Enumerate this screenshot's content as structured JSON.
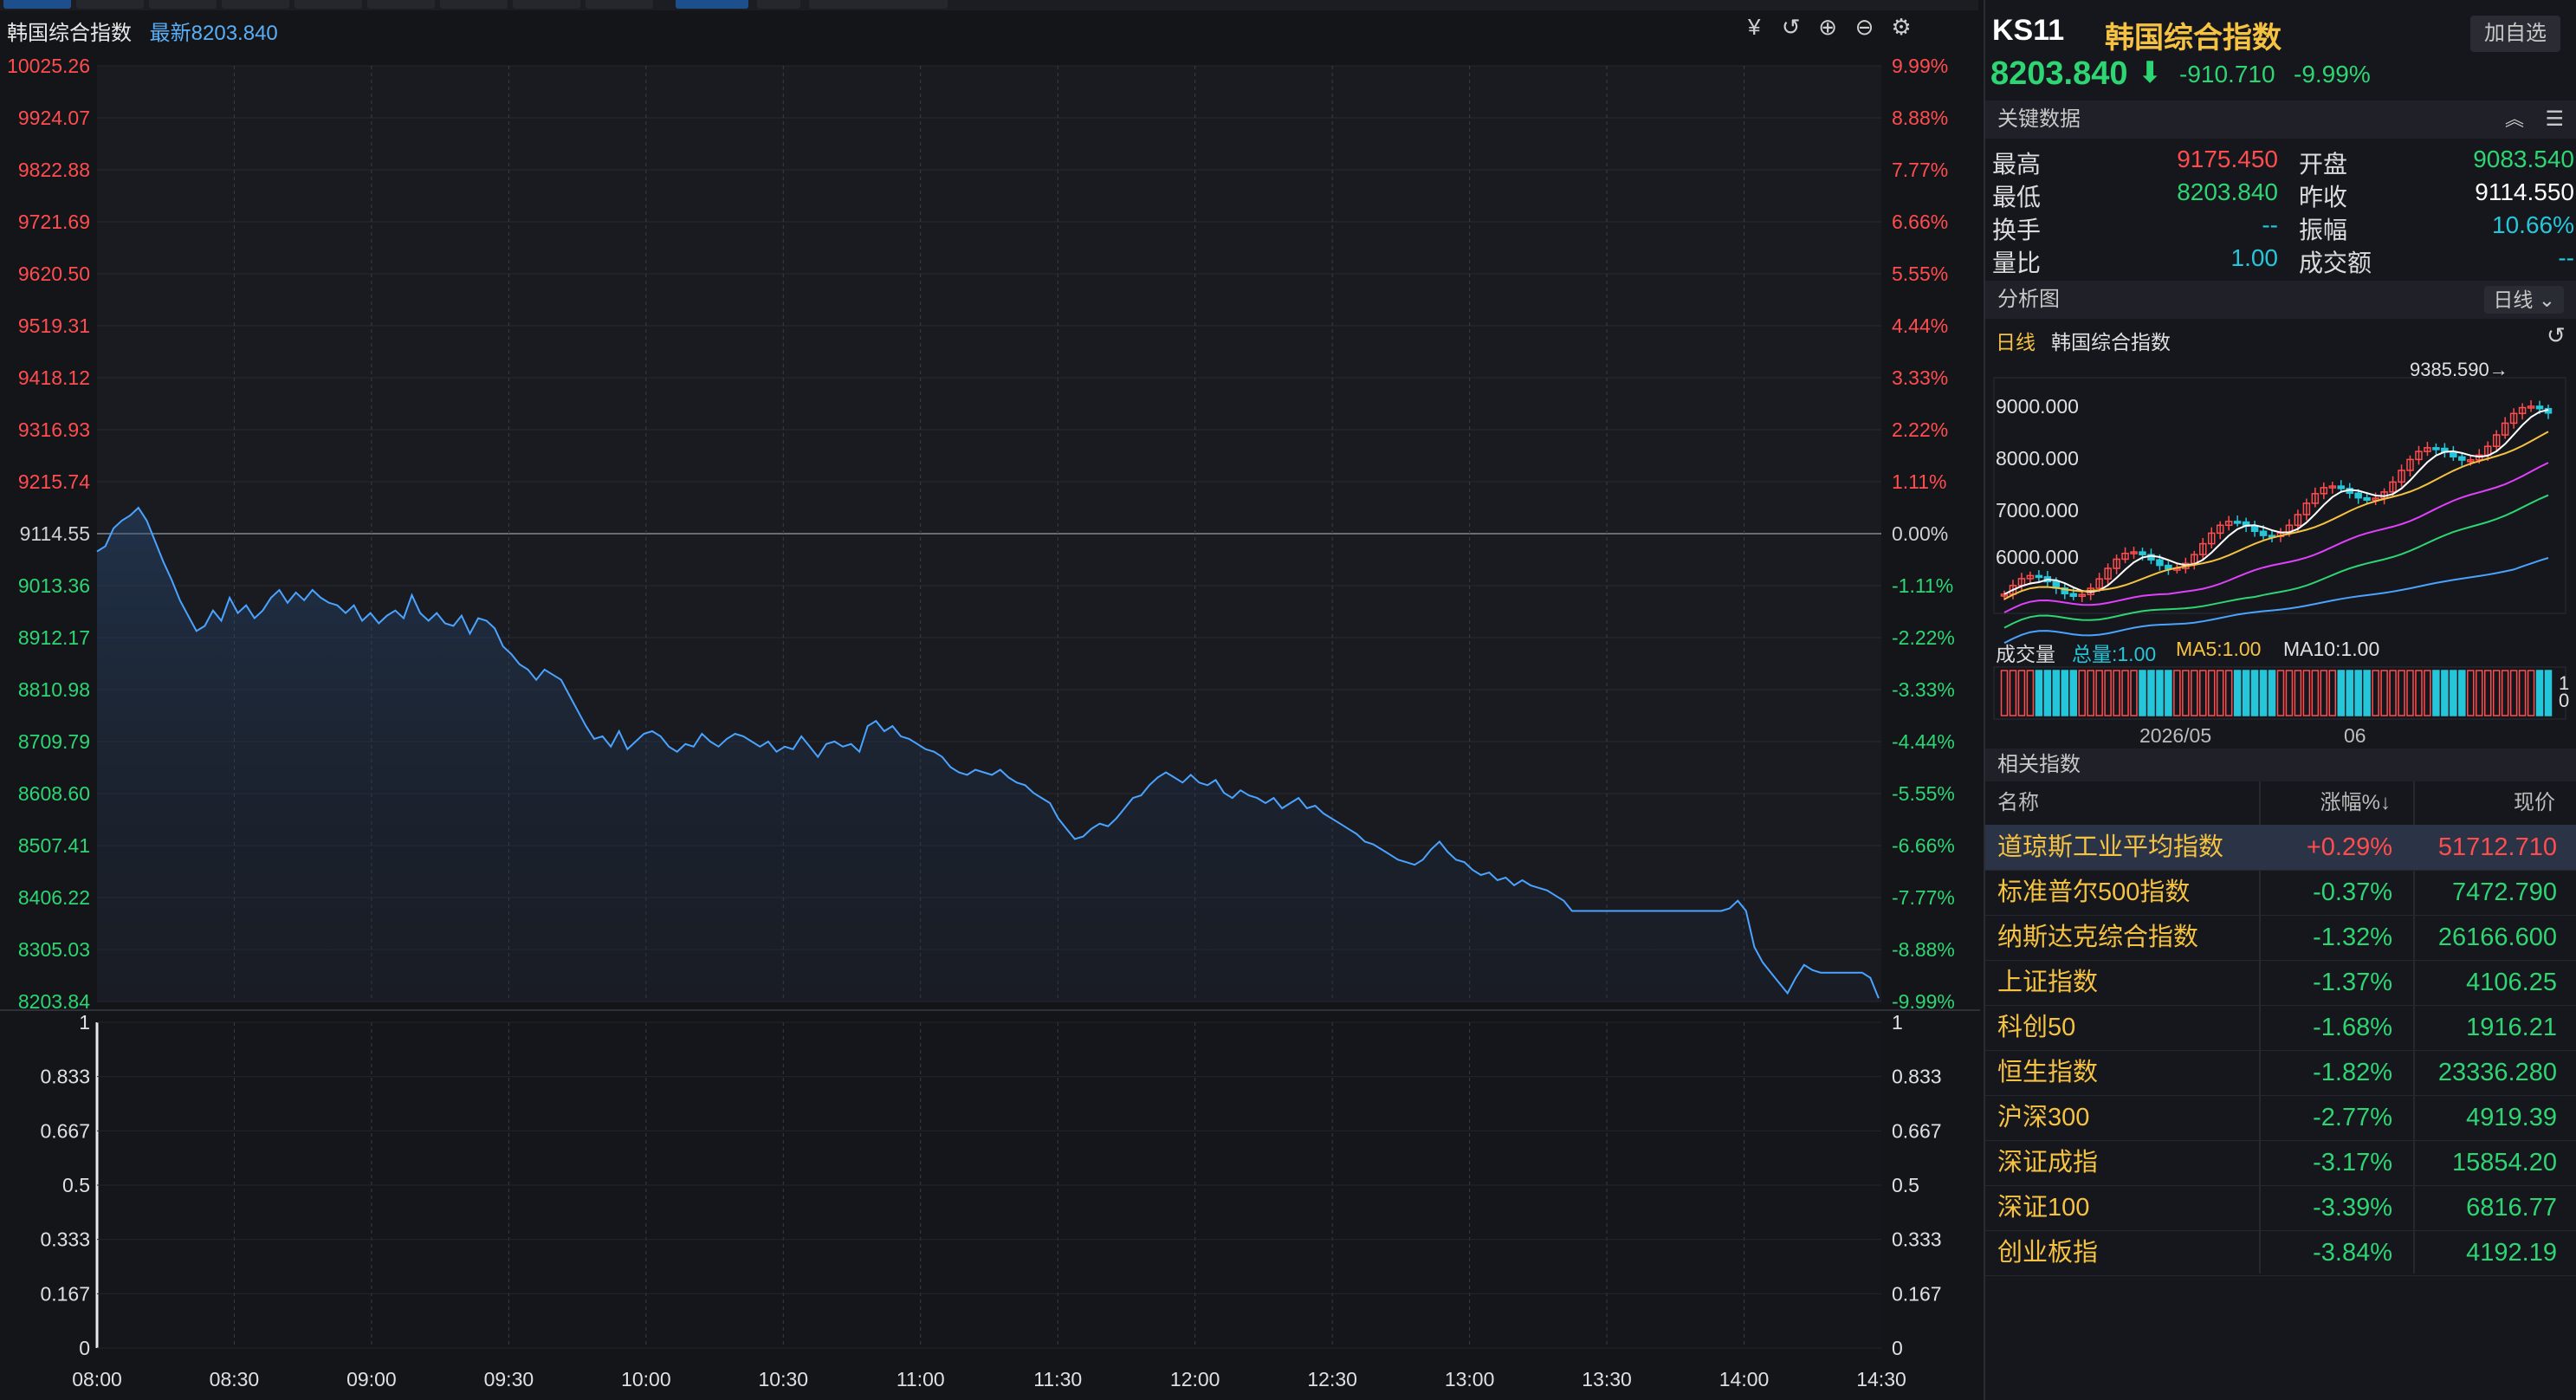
{
  "chart_header": {
    "name": "韩国综合指数",
    "latest": "最新8203.840"
  },
  "toolbar": [
    "cny-icon",
    "undo-icon",
    "zoom-in-icon",
    "zoom-out-icon",
    "settings-icon"
  ],
  "price_axis": {
    "left": [
      "10025.26",
      "9924.07",
      "9822.88",
      "9721.69",
      "9620.50",
      "9519.31",
      "9418.12",
      "9316.93",
      "9215.74",
      "9114.55",
      "9013.36",
      "8912.17",
      "8810.98",
      "8709.79",
      "8608.60",
      "8507.41",
      "8406.22",
      "8305.03",
      "8203.84"
    ],
    "right": [
      "9.99%",
      "8.88%",
      "7.77%",
      "6.66%",
      "5.55%",
      "4.44%",
      "3.33%",
      "2.22%",
      "1.11%",
      "0.00%",
      "-1.11%",
      "-2.22%",
      "-3.33%",
      "-4.44%",
      "-5.55%",
      "-6.66%",
      "-7.77%",
      "-8.88%",
      "-9.99%"
    ],
    "colors": {
      "up": "#ff4d4f",
      "flat": "#d0d0d0",
      "down": "#2ed573"
    }
  },
  "volume_axis": [
    "1",
    "0.833",
    "0.667",
    "0.5",
    "0.333",
    "0.167",
    "0"
  ],
  "time_axis": [
    "08:00",
    "08:30",
    "09:00",
    "09:30",
    "10:00",
    "10:30",
    "11:00",
    "11:30",
    "12:00",
    "12:30",
    "13:00",
    "13:30",
    "14:00",
    "14:30"
  ],
  "intraday": {
    "line_color": "#4aa3ff",
    "prev_close": 9114.55,
    "points": [
      [
        0,
        9080
      ],
      [
        5,
        9090
      ],
      [
        10,
        9125
      ],
      [
        15,
        9140
      ],
      [
        20,
        9150
      ],
      [
        25,
        9165
      ],
      [
        30,
        9140
      ],
      [
        35,
        9100
      ],
      [
        40,
        9060
      ],
      [
        45,
        9025
      ],
      [
        50,
        8985
      ],
      [
        55,
        8955
      ],
      [
        60,
        8925
      ],
      [
        65,
        8935
      ],
      [
        70,
        8965
      ],
      [
        75,
        8945
      ],
      [
        80,
        8990
      ],
      [
        85,
        8960
      ],
      [
        90,
        8975
      ],
      [
        95,
        8950
      ],
      [
        100,
        8965
      ],
      [
        105,
        8990
      ],
      [
        110,
        9005
      ],
      [
        115,
        8980
      ],
      [
        120,
        9000
      ],
      [
        125,
        8985
      ],
      [
        130,
        9005
      ],
      [
        135,
        8990
      ],
      [
        140,
        8980
      ],
      [
        145,
        8975
      ],
      [
        150,
        8960
      ],
      [
        155,
        8975
      ],
      [
        160,
        8945
      ],
      [
        165,
        8960
      ],
      [
        170,
        8940
      ],
      [
        175,
        8955
      ],
      [
        180,
        8965
      ],
      [
        185,
        8950
      ],
      [
        190,
        8995
      ],
      [
        195,
        8960
      ],
      [
        200,
        8945
      ],
      [
        205,
        8960
      ],
      [
        210,
        8940
      ],
      [
        215,
        8935
      ],
      [
        220,
        8955
      ],
      [
        225,
        8920
      ],
      [
        230,
        8950
      ],
      [
        235,
        8945
      ],
      [
        240,
        8930
      ],
      [
        245,
        8895
      ],
      [
        250,
        8880
      ],
      [
        255,
        8860
      ],
      [
        260,
        8850
      ],
      [
        265,
        8830
      ],
      [
        270,
        8850
      ],
      [
        275,
        8840
      ],
      [
        280,
        8830
      ],
      [
        285,
        8800
      ],
      [
        290,
        8770
      ],
      [
        295,
        8740
      ],
      [
        300,
        8715
      ],
      [
        305,
        8720
      ],
      [
        310,
        8700
      ],
      [
        315,
        8730
      ],
      [
        320,
        8695
      ],
      [
        325,
        8710
      ],
      [
        330,
        8725
      ],
      [
        335,
        8730
      ],
      [
        340,
        8720
      ],
      [
        345,
        8700
      ],
      [
        350,
        8690
      ],
      [
        355,
        8705
      ],
      [
        360,
        8700
      ],
      [
        365,
        8725
      ],
      [
        370,
        8710
      ],
      [
        375,
        8700
      ],
      [
        380,
        8715
      ],
      [
        385,
        8725
      ],
      [
        390,
        8720
      ],
      [
        395,
        8710
      ],
      [
        400,
        8700
      ],
      [
        405,
        8710
      ],
      [
        410,
        8690
      ],
      [
        415,
        8700
      ],
      [
        420,
        8695
      ],
      [
        425,
        8720
      ],
      [
        430,
        8700
      ],
      [
        435,
        8680
      ],
      [
        440,
        8705
      ],
      [
        445,
        8710
      ],
      [
        450,
        8700
      ],
      [
        455,
        8705
      ],
      [
        460,
        8690
      ],
      [
        465,
        8740
      ],
      [
        470,
        8750
      ],
      [
        475,
        8730
      ],
      [
        480,
        8740
      ],
      [
        485,
        8720
      ],
      [
        490,
        8715
      ],
      [
        495,
        8705
      ],
      [
        500,
        8695
      ],
      [
        505,
        8690
      ],
      [
        510,
        8680
      ],
      [
        515,
        8660
      ],
      [
        520,
        8650
      ],
      [
        525,
        8645
      ],
      [
        530,
        8655
      ],
      [
        535,
        8650
      ],
      [
        540,
        8645
      ],
      [
        545,
        8655
      ],
      [
        550,
        8640
      ],
      [
        555,
        8630
      ],
      [
        560,
        8625
      ],
      [
        565,
        8610
      ],
      [
        570,
        8600
      ],
      [
        575,
        8590
      ],
      [
        580,
        8560
      ],
      [
        585,
        8540
      ],
      [
        590,
        8520
      ],
      [
        595,
        8525
      ],
      [
        600,
        8540
      ],
      [
        605,
        8550
      ],
      [
        610,
        8545
      ],
      [
        615,
        8560
      ],
      [
        620,
        8580
      ],
      [
        625,
        8600
      ],
      [
        630,
        8605
      ],
      [
        635,
        8625
      ],
      [
        640,
        8640
      ],
      [
        645,
        8650
      ],
      [
        650,
        8640
      ],
      [
        655,
        8630
      ],
      [
        660,
        8645
      ],
      [
        665,
        8630
      ],
      [
        670,
        8625
      ],
      [
        675,
        8635
      ],
      [
        680,
        8610
      ],
      [
        685,
        8600
      ],
      [
        690,
        8615
      ],
      [
        695,
        8605
      ],
      [
        700,
        8600
      ],
      [
        705,
        8590
      ],
      [
        710,
        8600
      ],
      [
        715,
        8580
      ],
      [
        720,
        8590
      ],
      [
        725,
        8600
      ],
      [
        730,
        8580
      ],
      [
        735,
        8585
      ],
      [
        740,
        8570
      ],
      [
        745,
        8560
      ],
      [
        750,
        8550
      ],
      [
        755,
        8540
      ],
      [
        760,
        8530
      ],
      [
        765,
        8515
      ],
      [
        770,
        8510
      ],
      [
        775,
        8500
      ],
      [
        780,
        8490
      ],
      [
        785,
        8480
      ],
      [
        790,
        8475
      ],
      [
        795,
        8470
      ],
      [
        800,
        8480
      ],
      [
        805,
        8500
      ],
      [
        810,
        8515
      ],
      [
        815,
        8495
      ],
      [
        820,
        8480
      ],
      [
        825,
        8475
      ],
      [
        830,
        8460
      ],
      [
        835,
        8450
      ],
      [
        840,
        8455
      ],
      [
        845,
        8440
      ],
      [
        850,
        8445
      ],
      [
        855,
        8430
      ],
      [
        860,
        8440
      ],
      [
        865,
        8430
      ],
      [
        870,
        8425
      ],
      [
        875,
        8420
      ],
      [
        880,
        8410
      ],
      [
        885,
        8400
      ],
      [
        890,
        8380
      ],
      [
        895,
        8380
      ],
      [
        900,
        8380
      ],
      [
        910,
        8380
      ],
      [
        920,
        8380
      ],
      [
        930,
        8380
      ],
      [
        940,
        8380
      ],
      [
        950,
        8380
      ],
      [
        960,
        8380
      ],
      [
        970,
        8380
      ],
      [
        980,
        8380
      ],
      [
        985,
        8385
      ],
      [
        990,
        8400
      ],
      [
        995,
        8380
      ],
      [
        1000,
        8310
      ],
      [
        1005,
        8280
      ],
      [
        1010,
        8260
      ],
      [
        1015,
        8240
      ],
      [
        1020,
        8220
      ],
      [
        1025,
        8250
      ],
      [
        1030,
        8275
      ],
      [
        1035,
        8265
      ],
      [
        1040,
        8260
      ],
      [
        1045,
        8260
      ],
      [
        1050,
        8260
      ],
      [
        1055,
        8260
      ],
      [
        1060,
        8260
      ],
      [
        1065,
        8260
      ],
      [
        1070,
        8250
      ],
      [
        1075,
        8210
      ]
    ]
  },
  "quote": {
    "code": "KS11",
    "name": "韩国综合指数",
    "add_label": "加自选",
    "price": "8203.840",
    "change": "-910.710",
    "change_pct": "-9.99%"
  },
  "key_data": {
    "title": "关键数据",
    "rows": [
      {
        "l1": "最高",
        "v1": "9175.450",
        "l2": "开盘",
        "v2": "9083.540"
      },
      {
        "l1": "最低",
        "v1": "8203.840",
        "l2": "昨收",
        "v2": "9114.550"
      },
      {
        "l1": "换手",
        "v1": "--",
        "l2": "振幅",
        "v2": "10.66%"
      },
      {
        "l1": "量比",
        "v1": "1.00",
        "l2": "成交额",
        "v2": "--"
      }
    ]
  },
  "analysis": {
    "title": "分析图",
    "period": "日线",
    "sub_label_period": "日线",
    "sub_label_name": "韩国综合指数",
    "max_label": "9385.590→",
    "y_labels": [
      "9000.000",
      "8000.000",
      "7000.000",
      "6000.000"
    ],
    "volume_label": "成交量",
    "volume_total": "总量:1.00",
    "ma5": "MA5:1.00",
    "ma10": "MA10:1.00",
    "date_labels": [
      "2026/05",
      "06"
    ],
    "vol_right": [
      "1",
      "0"
    ]
  },
  "related": {
    "title": "相关指数",
    "headers": {
      "name": "名称",
      "pct": "涨幅%↓",
      "price": "现价"
    },
    "rows": [
      {
        "name": "道琼斯工业平均指数",
        "pct": "+0.29%",
        "price": "51712.710",
        "up": true
      },
      {
        "name": "标准普尔500指数",
        "pct": "-0.37%",
        "price": "7472.790",
        "up": false
      },
      {
        "name": "纳斯达克综合指数",
        "pct": "-1.32%",
        "price": "26166.600",
        "up": false
      },
      {
        "name": "上证指数",
        "pct": "-1.37%",
        "price": "4106.25",
        "up": false
      },
      {
        "name": "科创50",
        "pct": "-1.68%",
        "price": "1916.21",
        "up": false
      },
      {
        "name": "恒生指数",
        "pct": "-1.82%",
        "price": "23336.280",
        "up": false
      },
      {
        "name": "沪深300",
        "pct": "-2.77%",
        "price": "4919.39",
        "up": false
      },
      {
        "name": "深证成指",
        "pct": "-3.17%",
        "price": "15854.20",
        "up": false
      },
      {
        "name": "深证100",
        "pct": "-3.39%",
        "price": "6816.77",
        "up": false
      },
      {
        "name": "创业板指",
        "pct": "-3.84%",
        "price": "4192.19",
        "up": false
      }
    ]
  }
}
